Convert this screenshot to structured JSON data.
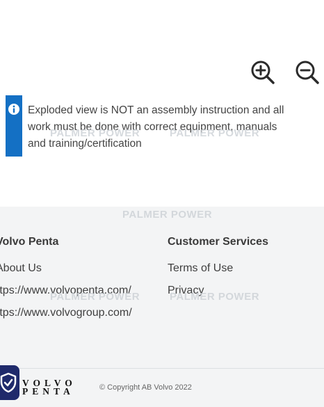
{
  "toolbar": {
    "zoom_in_icon": "zoom-in-icon",
    "zoom_out_icon": "zoom-out-icon"
  },
  "notice": {
    "icon": "info-icon",
    "accent_color": "#1470c4",
    "lines": [
      "Exploded view is NOT an assembly instruction and all",
      "work must be done with correct equipment, manuals",
      "and training/certification"
    ]
  },
  "watermark": {
    "text": "PALMER POWER"
  },
  "footer": {
    "col1": {
      "heading": "Volvo Penta",
      "links": [
        "About Us",
        "https://www.volvopenta.com/",
        "https://www.volvogroup.com/"
      ]
    },
    "col2": {
      "heading": "Customer Services",
      "links": [
        "Terms of Use",
        "Privacy"
      ]
    },
    "logo_lines": [
      "VOLVO",
      "PENTA"
    ],
    "copyright": "© Copyright AB Volvo 2022",
    "shield_color": "#1f2a6b"
  }
}
